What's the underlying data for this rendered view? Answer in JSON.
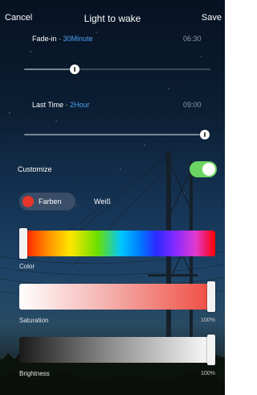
{
  "header": {
    "cancel_label": "Cancel",
    "title": "Light to wake",
    "save_label": "Save"
  },
  "fade_in": {
    "label": "Fade-in",
    "separator": " · ",
    "value": "30Minute",
    "time": "06:30",
    "slider_fraction": 0.26
  },
  "last_time": {
    "label": "Last Time",
    "separator": " · ",
    "value": "2Hour",
    "time": "09:00",
    "slider_fraction": 1.0
  },
  "customize": {
    "label": "Customize",
    "enabled": true
  },
  "modes": {
    "active_label": "Farben",
    "other_label": "Weiß",
    "active_color": "#e8352a"
  },
  "color": {
    "caption": "Color",
    "slider_fraction": 0.0
  },
  "saturation": {
    "caption": "Saturation",
    "percent": "100%",
    "slider_fraction": 1.0
  },
  "brightness": {
    "caption": "Brightness",
    "percent": "100%",
    "slider_fraction": 1.0
  },
  "colors": {
    "accent": "#4aa0f5",
    "toggle_on": "#6cd462",
    "active_dot": "#e8352a"
  },
  "icons": {
    "slider_knob": "slider-knob-icon",
    "color_dot": "color-dot-icon"
  }
}
